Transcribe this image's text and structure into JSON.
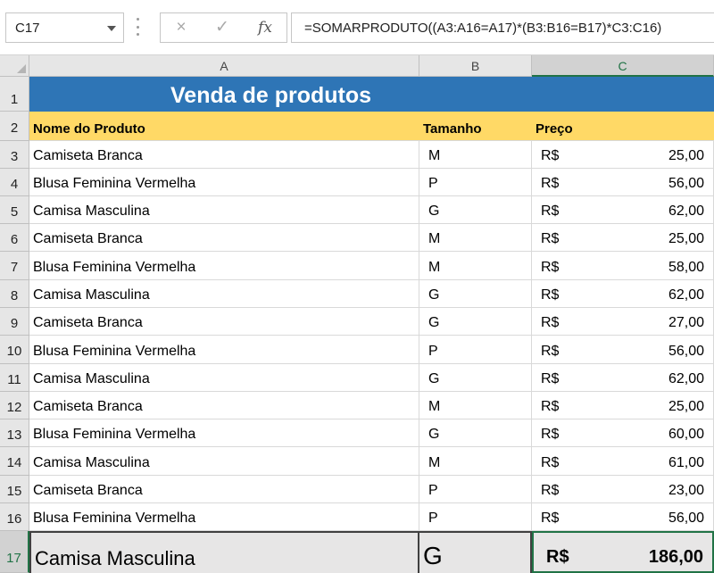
{
  "formula_bar": {
    "name_box": "C17",
    "cancel_icon": "×",
    "enter_icon": "✓",
    "fx_label": "fx",
    "formula": "=SOMARPRODUTO((A3:A16=A17)*(B3:B16=B17)*C3:C16)"
  },
  "columns": [
    "A",
    "B",
    "C"
  ],
  "selected_column": "C",
  "title": "Venda de produtos",
  "headers": {
    "name": "Nome do Produto",
    "size": "Tamanho",
    "price": "Preço"
  },
  "rows": [
    {
      "num": "1"
    },
    {
      "num": "2"
    },
    {
      "num": "3",
      "product": "Camiseta Branca",
      "size": "M",
      "currency": "R$",
      "price": "25,00"
    },
    {
      "num": "4",
      "product": "Blusa Feminina Vermelha",
      "size": "P",
      "currency": "R$",
      "price": "56,00"
    },
    {
      "num": "5",
      "product": "Camisa Masculina",
      "size": "G",
      "currency": "R$",
      "price": "62,00"
    },
    {
      "num": "6",
      "product": "Camiseta Branca",
      "size": "M",
      "currency": "R$",
      "price": "25,00"
    },
    {
      "num": "7",
      "product": "Blusa Feminina Vermelha",
      "size": "M",
      "currency": "R$",
      "price": "58,00"
    },
    {
      "num": "8",
      "product": "Camisa Masculina",
      "size": "G",
      "currency": "R$",
      "price": "62,00"
    },
    {
      "num": "9",
      "product": "Camiseta Branca",
      "size": "G",
      "currency": "R$",
      "price": "27,00"
    },
    {
      "num": "10",
      "product": "Blusa Feminina Vermelha",
      "size": "P",
      "currency": "R$",
      "price": "56,00"
    },
    {
      "num": "11",
      "product": "Camisa Masculina",
      "size": "G",
      "currency": "R$",
      "price": "62,00"
    },
    {
      "num": "12",
      "product": "Camiseta Branca",
      "size": "M",
      "currency": "R$",
      "price": "25,00"
    },
    {
      "num": "13",
      "product": "Blusa Feminina Vermelha",
      "size": "G",
      "currency": "R$",
      "price": "60,00"
    },
    {
      "num": "14",
      "product": "Camisa Masculina",
      "size": "M",
      "currency": "R$",
      "price": "61,00"
    },
    {
      "num": "15",
      "product": "Camiseta Branca",
      "size": "P",
      "currency": "R$",
      "price": "23,00"
    },
    {
      "num": "16",
      "product": "Blusa Feminina Vermelha",
      "size": "P",
      "currency": "R$",
      "price": "56,00"
    },
    {
      "num": "17"
    }
  ],
  "total": {
    "product": "Camisa Masculina",
    "size": "G",
    "currency": "R$",
    "price": "186,00"
  },
  "colors": {
    "title_fill": "#2e75b6",
    "header_fill": "#ffd966",
    "total_fill": "#e7e6e6",
    "selection": "#217346"
  }
}
